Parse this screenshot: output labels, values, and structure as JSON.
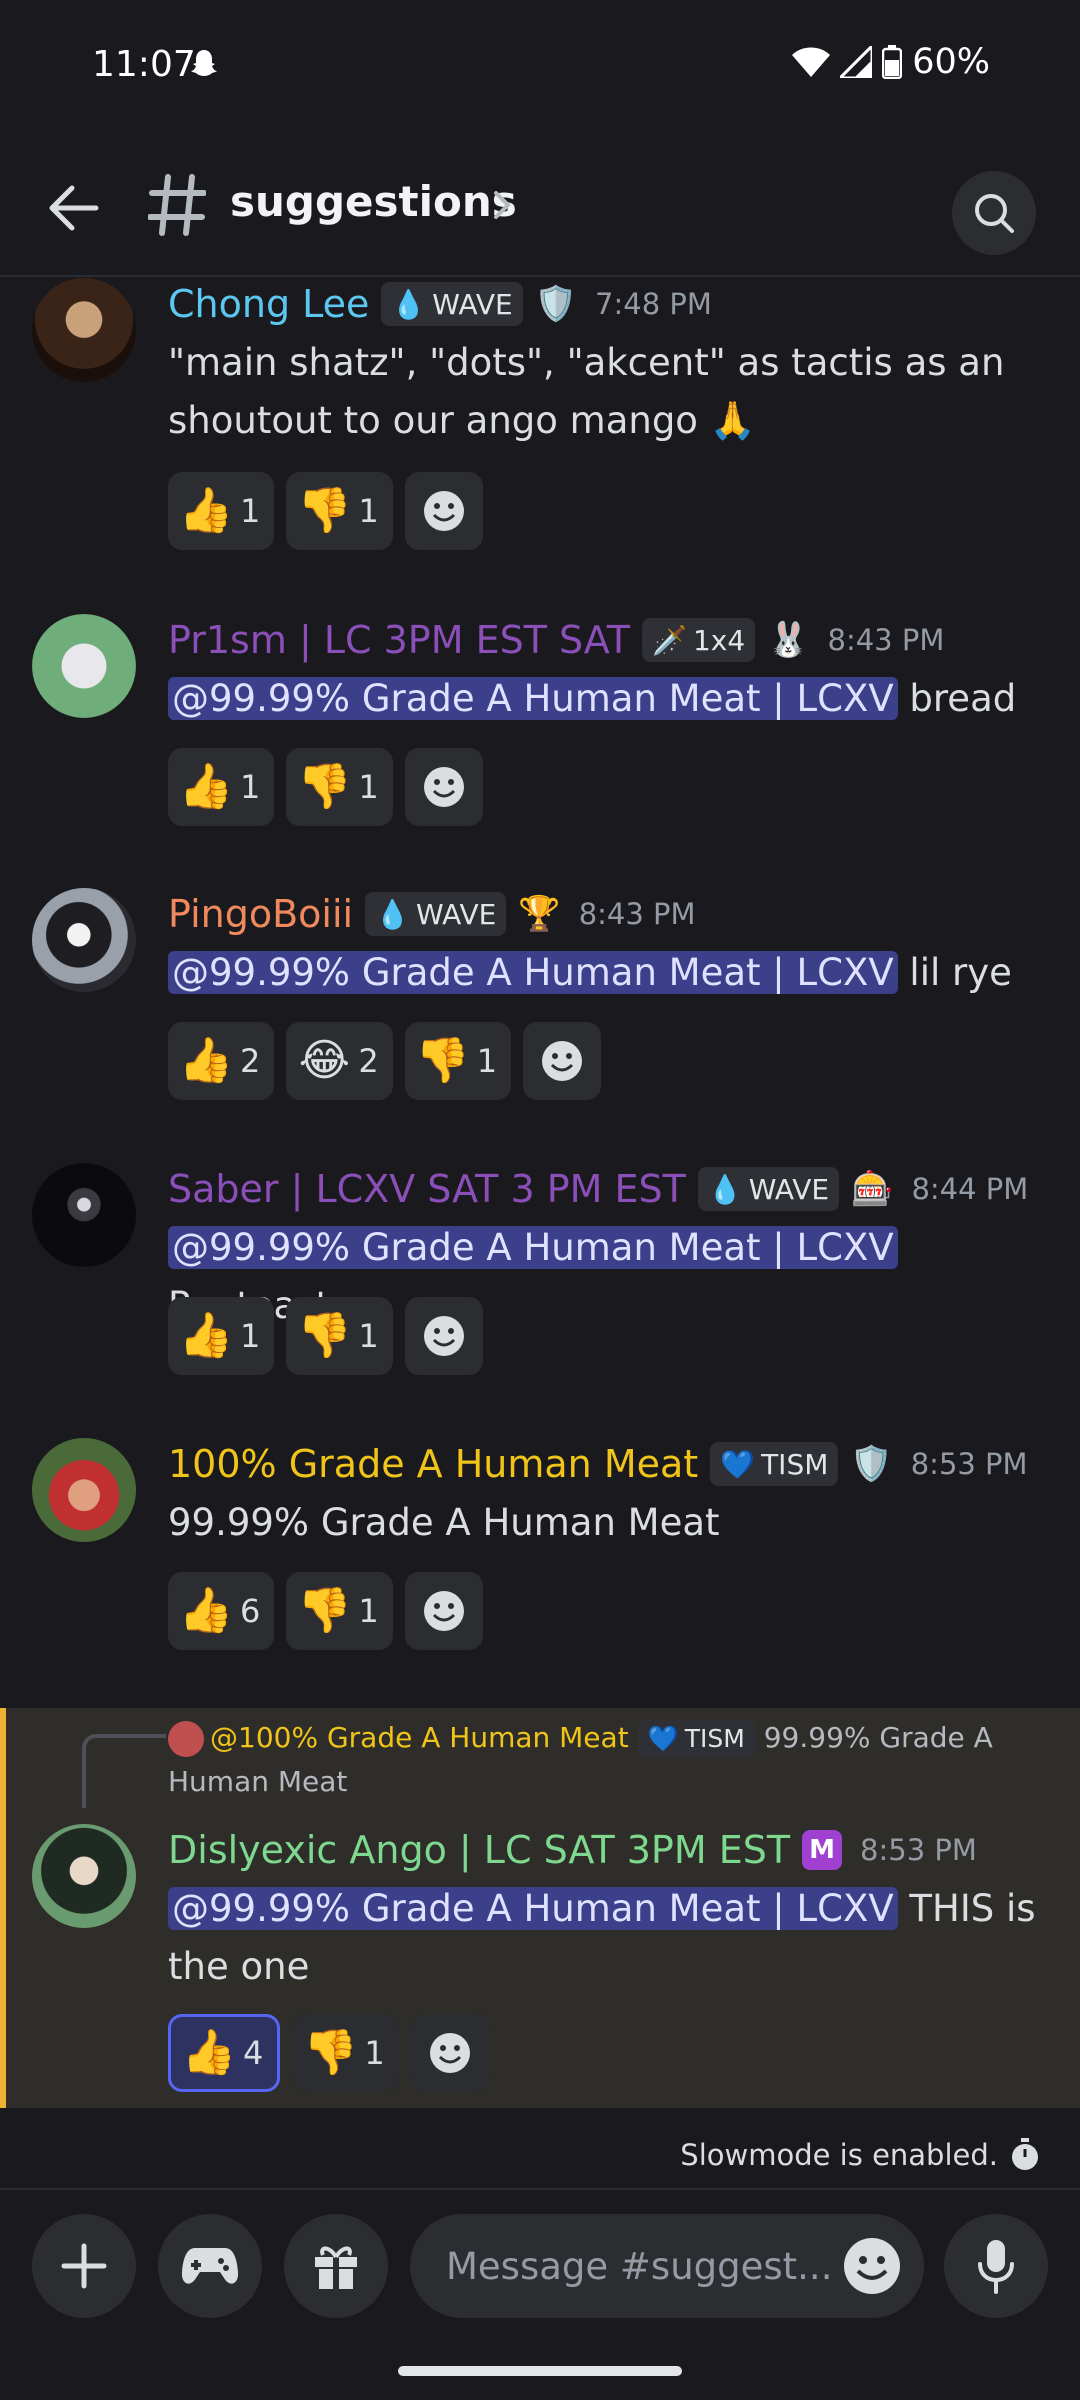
{
  "status_bar": {
    "time": "11:07",
    "battery": "60%"
  },
  "header": {
    "channel": "suggestions"
  },
  "messages": [
    {
      "author": "Chong Lee",
      "author_color": "#5cc8f2",
      "badge": "WAVE",
      "time": "7:48 PM",
      "text": "\"main shatz\", \"dots\", \"akcent\" as tactis as an shoutout to our ango mango 🙏",
      "reactions": [
        {
          "emoji": "👍",
          "count": "1"
        },
        {
          "emoji": "👎",
          "count": "1"
        }
      ]
    },
    {
      "author": "Pr1sm | LC 3PM EST SAT",
      "author_color": "#8a4fb8",
      "badge": "1x4",
      "time": "8:43 PM",
      "mention": "@99.99% Grade A Human Meat | LCXV",
      "text": " bread",
      "reactions": [
        {
          "emoji": "👍",
          "count": "1"
        },
        {
          "emoji": "👎",
          "count": "1"
        }
      ]
    },
    {
      "author": "PingoBoiii",
      "author_color": "#f08a5d",
      "badge": "WAVE",
      "time": "8:43 PM",
      "mention": "@99.99% Grade A Human Meat | LCXV",
      "text": " lil rye",
      "reactions": [
        {
          "emoji": "👍",
          "count": "2"
        },
        {
          "emoji": "😂",
          "count": "2"
        },
        {
          "emoji": "👎",
          "count": "1"
        }
      ]
    },
    {
      "author": "Saber | LCXV SAT 3 PM EST",
      "author_color": "#8a4fb8",
      "badge": "WAVE",
      "time": "8:44 PM",
      "mention": "@99.99% Grade A Human Meat | LCXV",
      "text": " Ryetoast",
      "reactions": [
        {
          "emoji": "👍",
          "count": "1"
        },
        {
          "emoji": "👎",
          "count": "1"
        }
      ]
    },
    {
      "author": "100% Grade A Human Meat",
      "author_color": "#f0c419",
      "badge": "TISM",
      "time": "8:53 PM",
      "text": "99.99% Grade A Human Meat",
      "reactions": [
        {
          "emoji": "👍",
          "count": "6"
        },
        {
          "emoji": "👎",
          "count": "1"
        }
      ]
    },
    {
      "reply_author": "@100% Grade A Human Meat",
      "reply_badge": "TISM",
      "reply_text": "99.99% Grade A Human Meat",
      "author": "Dislyexic Ango | LC SAT 3PM EST",
      "author_color": "#7fd88f",
      "time": "8:53 PM",
      "mention": "@99.99% Grade A Human Meat | LCXV",
      "text": " THIS is the one",
      "reactions": [
        {
          "emoji": "👍",
          "count": "4"
        },
        {
          "emoji": "👎",
          "count": "1"
        }
      ]
    }
  ],
  "slowmode": "Slowmode is enabled.",
  "composer": {
    "placeholder": "Message #suggest..."
  },
  "colors": {
    "background": "#1a1a1e",
    "mention_bg": "#3c3f8a",
    "highlight_border": "#f0b232",
    "blurple": "#5865f2"
  }
}
